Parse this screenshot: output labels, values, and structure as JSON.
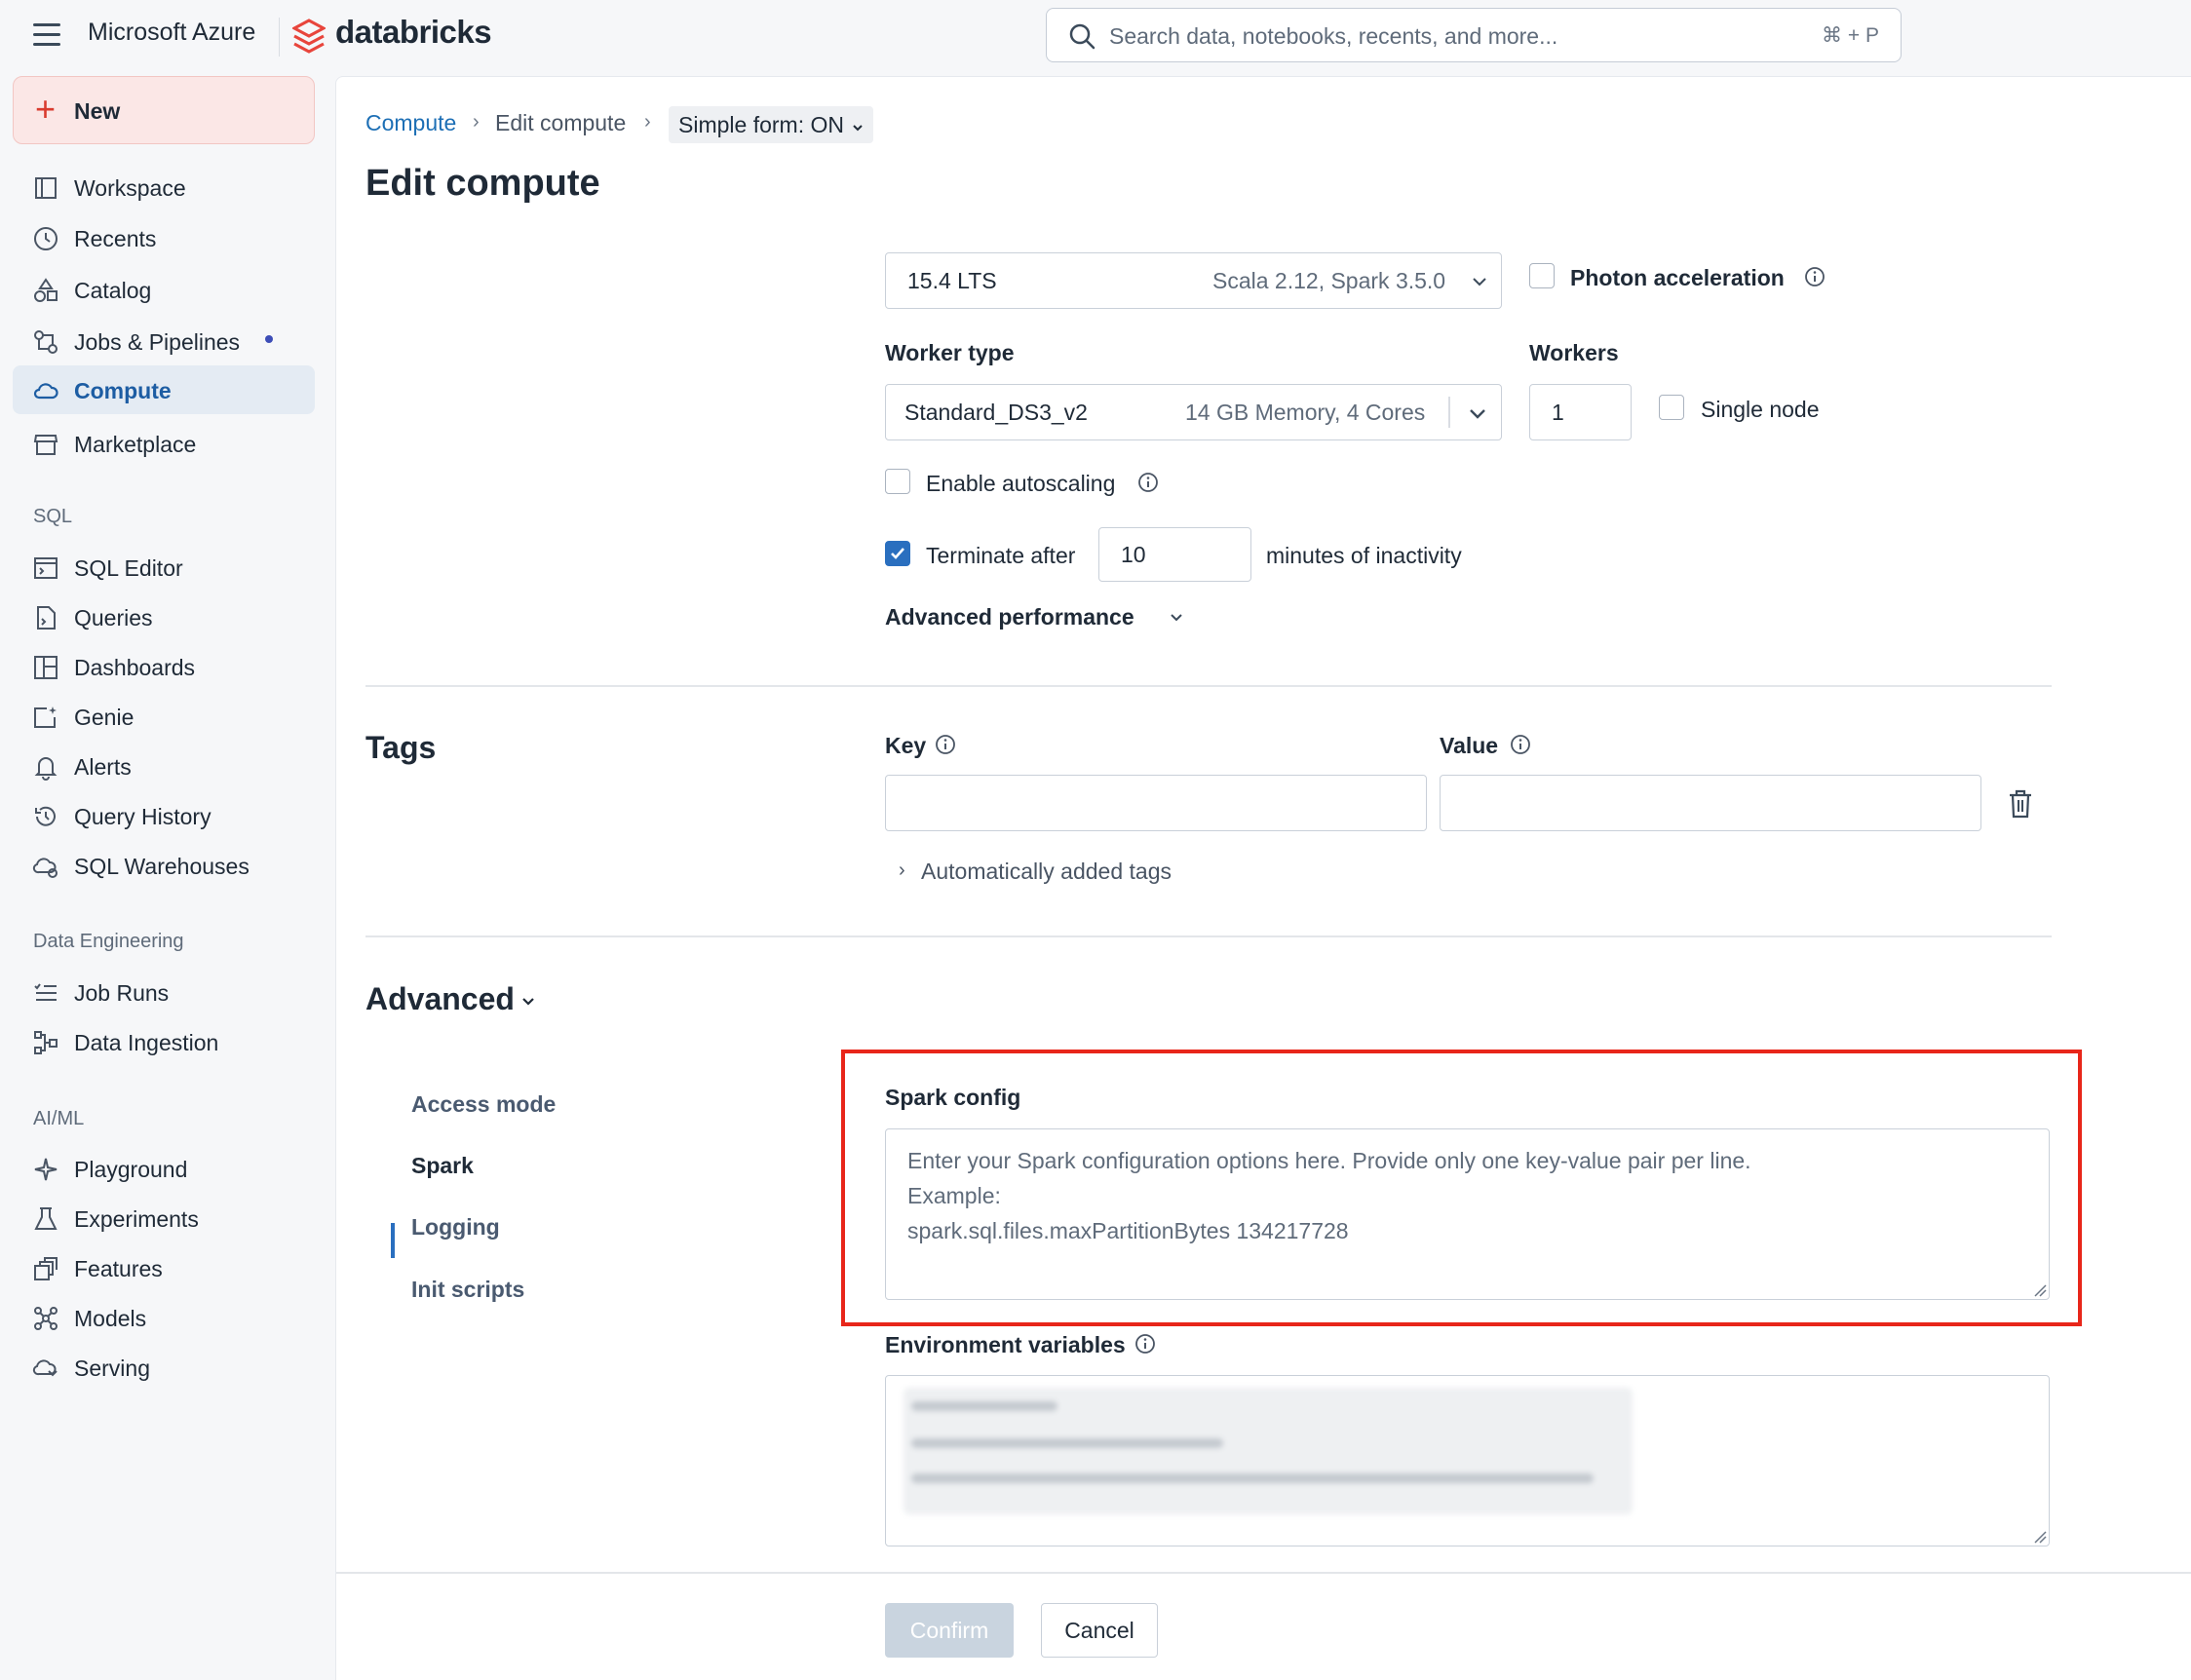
{
  "topbar": {
    "cloud": "Microsoft Azure",
    "product": "databricks",
    "search_placeholder": "Search data, notebooks, recents, and more...",
    "search_shortcut": "⌘ + P"
  },
  "sidebar": {
    "new_label": "New",
    "items": [
      {
        "label": "Workspace",
        "icon": "workspace-icon"
      },
      {
        "label": "Recents",
        "icon": "clock-icon"
      },
      {
        "label": "Catalog",
        "icon": "catalog-icon"
      },
      {
        "label": "Jobs & Pipelines",
        "icon": "workflow-icon"
      },
      {
        "label": "Compute",
        "icon": "cloud-icon"
      },
      {
        "label": "Marketplace",
        "icon": "store-icon"
      }
    ],
    "sql_section": "SQL",
    "sql_items": [
      {
        "label": "SQL Editor"
      },
      {
        "label": "Queries"
      },
      {
        "label": "Dashboards"
      },
      {
        "label": "Genie"
      },
      {
        "label": "Alerts"
      },
      {
        "label": "Query History"
      },
      {
        "label": "SQL Warehouses"
      }
    ],
    "de_section": "Data Engineering",
    "de_items": [
      {
        "label": "Job Runs"
      },
      {
        "label": "Data Ingestion"
      }
    ],
    "ml_section": "AI/ML",
    "ml_items": [
      {
        "label": "Playground"
      },
      {
        "label": "Experiments"
      },
      {
        "label": "Features"
      },
      {
        "label": "Models"
      },
      {
        "label": "Serving"
      }
    ]
  },
  "breadcrumb": {
    "root": "Compute",
    "current": "Edit compute",
    "simple_form": "Simple form: ON"
  },
  "page": {
    "title": "Edit compute"
  },
  "runtime": {
    "version": "15.4 LTS",
    "details": "Scala 2.12, Spark 3.5.0"
  },
  "photon": {
    "label": "Photon acceleration",
    "checked": false
  },
  "worker": {
    "type_label": "Worker type",
    "type_value": "Standard_DS3_v2",
    "type_details": "14 GB Memory, 4 Cores",
    "workers_label": "Workers",
    "workers_value": "1",
    "single_node_label": "Single node"
  },
  "autoscaling": {
    "label": "Enable autoscaling",
    "checked": false
  },
  "terminate": {
    "label": "Terminate after",
    "value": "10",
    "suffix": "minutes of inactivity",
    "checked": true
  },
  "advanced_performance": {
    "label": "Advanced performance"
  },
  "tags": {
    "heading": "Tags",
    "key_label": "Key",
    "value_label": "Value",
    "auto_tags": "Automatically added tags"
  },
  "advanced": {
    "heading": "Advanced",
    "nav": [
      "Access mode",
      "Spark",
      "Logging",
      "Init scripts"
    ],
    "active_nav": "Spark",
    "spark_config_label": "Spark config",
    "spark_config_placeholder": [
      "Enter your Spark configuration options here. Provide only one key-value pair per line.",
      "Example:",
      "spark.sql.files.maxPartitionBytes 134217728"
    ],
    "env_label": "Environment variables"
  },
  "footer": {
    "confirm": "Confirm",
    "cancel": "Cancel"
  },
  "colors": {
    "accent": "#2a6fbf",
    "highlight": "#e8261a",
    "brand": "#e8453c"
  }
}
